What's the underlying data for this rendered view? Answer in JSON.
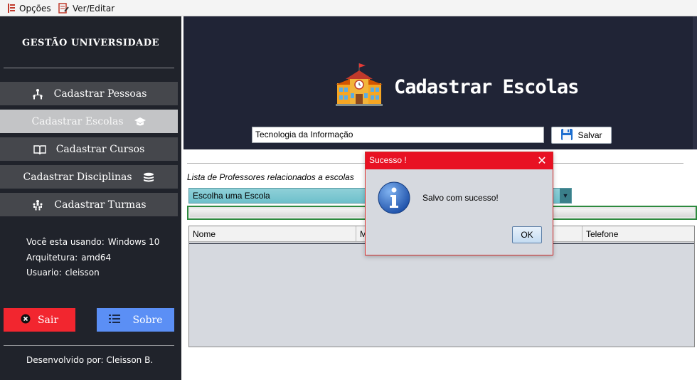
{
  "menubar": {
    "items": [
      {
        "label": "Opções",
        "icon": "options-icon"
      },
      {
        "label": "Ver/Editar",
        "icon": "edit-icon"
      }
    ]
  },
  "sidebar": {
    "brand": "GESTÃO UNIVERSIDADE",
    "nav": [
      {
        "label": "Cadastrar Pessoas",
        "icon": "people-icon",
        "active": false
      },
      {
        "label": "Cadastrar Escolas",
        "icon": "graduation-cap-icon",
        "active": true
      },
      {
        "label": "Cadastrar Cursos",
        "icon": "book-icon",
        "active": false
      },
      {
        "label": "Cadastrar Disciplinas",
        "icon": "stack-icon",
        "active": false
      },
      {
        "label": "Cadastrar Turmas",
        "icon": "group-icon",
        "active": false
      }
    ],
    "sysinfo": [
      {
        "key": "Você esta usando:",
        "value": "Windows 10"
      },
      {
        "key": "Arquitetura:",
        "value": "amd64"
      },
      {
        "key": "Usuario:",
        "value": "cleisson"
      }
    ],
    "buttons": {
      "exit": "Sair",
      "about": "Sobre"
    },
    "footer": "Desenvolvido por: Cleisson B."
  },
  "main": {
    "title": "Cadastrar Escolas",
    "school_name_value": "Tecnologia da Informação",
    "save_label": "Salvar",
    "list_label": "Lista de Professores relacionados a escolas",
    "combo_selected": "Escolha uma Escola",
    "table": {
      "columns": [
        "Nome",
        "M",
        "",
        "Telefone"
      ],
      "rows": []
    }
  },
  "dialog": {
    "title": "Sucesso !",
    "message": "Salvo com sucesso!",
    "ok_label": "OK",
    "close_symbol": "✕"
  },
  "colors": {
    "sidebar_bg": "#20232b",
    "header_bg": "#202436",
    "exit_button": "#f2262f",
    "about_button": "#5b8ff5",
    "dialog_title": "#e81123"
  }
}
